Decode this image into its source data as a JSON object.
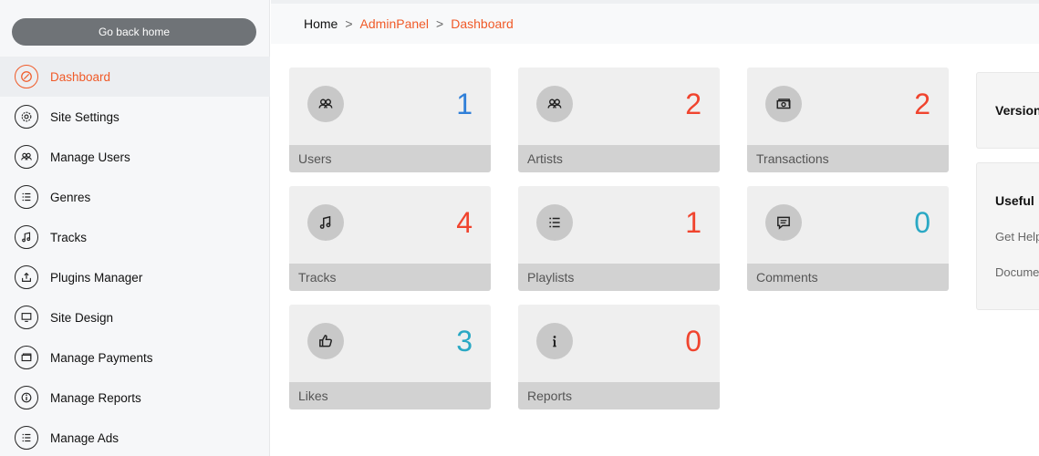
{
  "sidebar": {
    "back_button": "Go back home",
    "items": [
      {
        "label": "Dashboard",
        "icon": "dashboard-icon"
      },
      {
        "label": "Site Settings",
        "icon": "gear-icon"
      },
      {
        "label": "Manage Users",
        "icon": "users-icon"
      },
      {
        "label": "Genres",
        "icon": "list-icon"
      },
      {
        "label": "Tracks",
        "icon": "music-note-icon"
      },
      {
        "label": "Plugins Manager",
        "icon": "upload-icon"
      },
      {
        "label": "Site Design",
        "icon": "monitor-icon"
      },
      {
        "label": "Manage Payments",
        "icon": "wallet-icon"
      },
      {
        "label": "Manage Reports",
        "icon": "info-icon"
      },
      {
        "label": "Manage Ads",
        "icon": "list-icon"
      }
    ]
  },
  "breadcrumb": {
    "home": "Home",
    "sep": ">",
    "admin": "AdminPanel",
    "current": "Dashboard"
  },
  "stats": [
    {
      "label": "Users",
      "value": "1",
      "color": "#2f7fd8",
      "icon": "users-icon"
    },
    {
      "label": "Artists",
      "value": "2",
      "color": "#f0442e",
      "icon": "users-icon"
    },
    {
      "label": "Transactions",
      "value": "2",
      "color": "#f0442e",
      "icon": "money-icon"
    },
    {
      "label": "Tracks",
      "value": "4",
      "color": "#f0442e",
      "icon": "music-note-icon"
    },
    {
      "label": "Playlists",
      "value": "1",
      "color": "#f0442e",
      "icon": "list-icon"
    },
    {
      "label": "Comments",
      "value": "0",
      "color": "#2aa8c4",
      "icon": "comment-icon"
    },
    {
      "label": "Likes",
      "value": "3",
      "color": "#2aa8c4",
      "icon": "thumbs-up-icon"
    },
    {
      "label": "Reports",
      "value": "0",
      "color": "#f0442e",
      "icon": "info-icon"
    }
  ],
  "panels": {
    "version_title": "Version",
    "useful_title": "Useful",
    "useful_links": [
      "Get Help",
      "Docume"
    ]
  },
  "colors": {
    "accent": "#f05a28",
    "blue": "#2f7fd8",
    "teal": "#2aa8c4",
    "red": "#f0442e"
  }
}
